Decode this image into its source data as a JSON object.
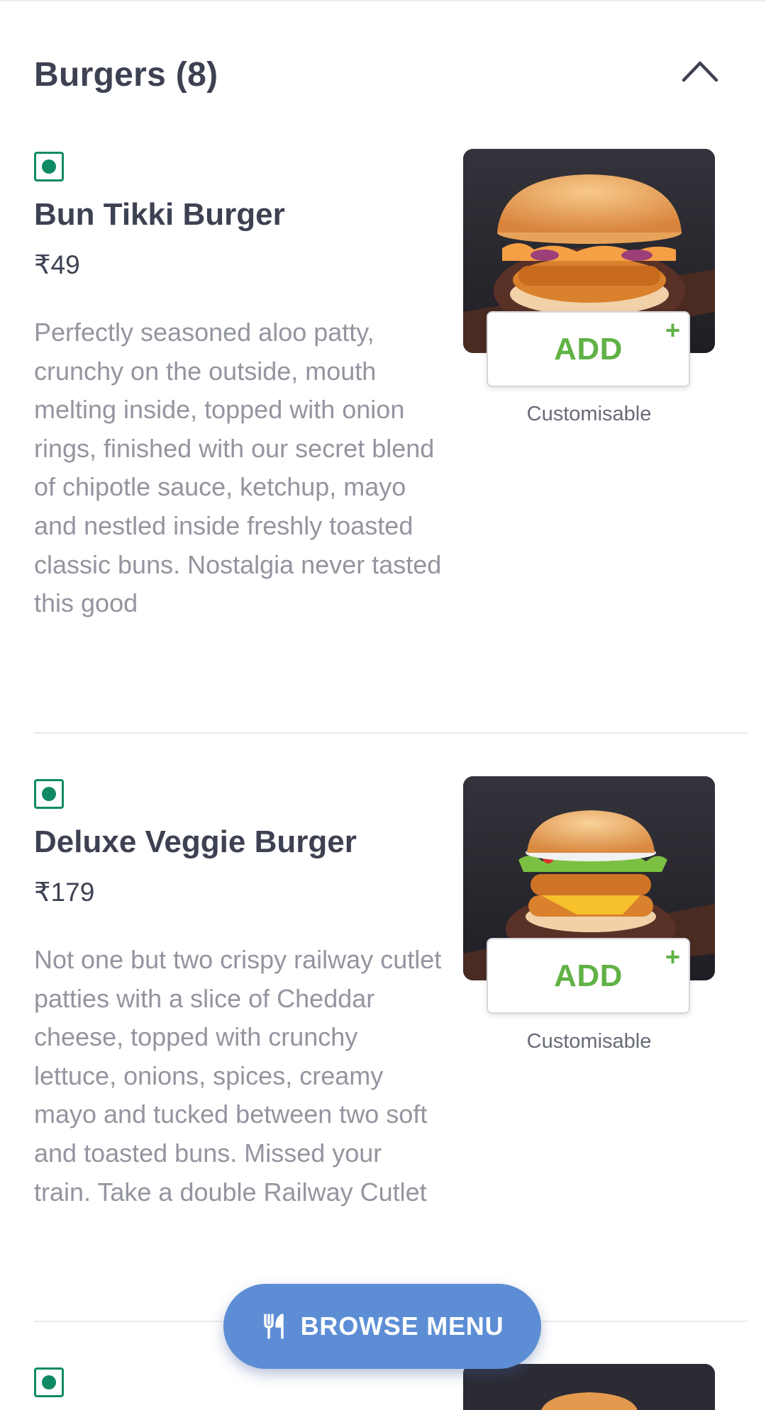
{
  "section": {
    "title": "Burgers (8)"
  },
  "items": [
    {
      "name": "Bun Tikki Burger",
      "price": "₹49",
      "description": "Perfectly seasoned aloo patty, crunchy on the outside, mouth melting inside, topped with onion rings, finished with our secret blend of chipotle sauce, ketchup, mayo and nestled inside freshly toasted classic buns. Nostalgia never tasted this good",
      "add_label": "ADD",
      "add_plus": "+",
      "note": "Customisable"
    },
    {
      "name": "Deluxe Veggie Burger",
      "price": "₹179",
      "description": "Not one but two crispy railway cutlet patties with a slice of Cheddar cheese, topped with crunchy lettuce, onions, spices, creamy mayo and tucked between two soft and toasted buns. Missed your train. Take a double Railway Cutlet",
      "add_label": "ADD",
      "add_plus": "+",
      "note": "Customisable"
    }
  ],
  "browse_menu": {
    "label": "BROWSE MENU",
    "icon": "fork-knife-icon"
  },
  "colors": {
    "veg_green": "#0f8a65",
    "add_green": "#60b246",
    "browse_blue": "#5d8ed5",
    "text_dark": "#3d4152",
    "text_muted": "#93959f"
  }
}
